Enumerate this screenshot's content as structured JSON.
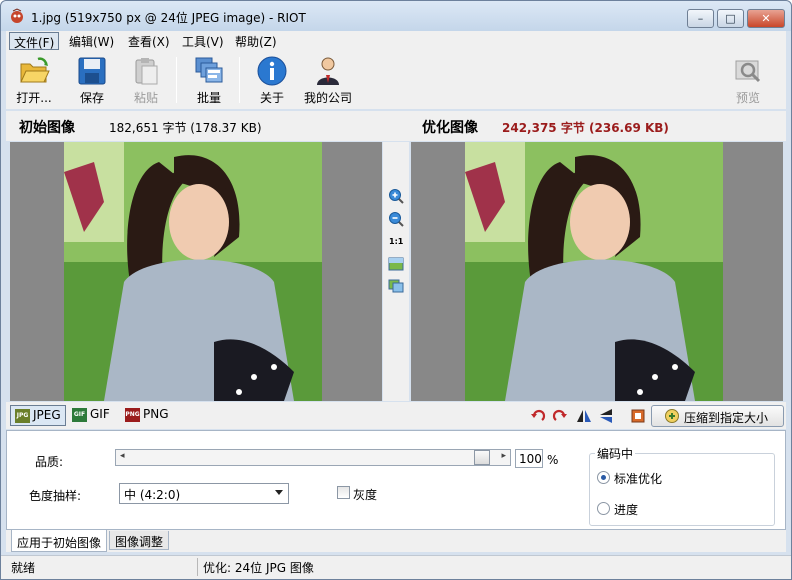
{
  "window": {
    "title": "1.jpg (519x750 px @ 24位 JPEG image) - RIOT",
    "buttons": {
      "minimize": "–",
      "maximize": "□",
      "close": "✕"
    }
  },
  "menu": [
    {
      "label": "文件(F)"
    },
    {
      "label": "编辑(W)"
    },
    {
      "label": "查看(X)"
    },
    {
      "label": "工具(V)"
    },
    {
      "label": "帮助(Z)"
    }
  ],
  "toolbar": {
    "open": "打开...",
    "save": "保存",
    "paste": "粘贴",
    "batch": "批量",
    "about": "关于",
    "company": "我的公司",
    "preview": "预览"
  },
  "original": {
    "title": "初始图像",
    "size": "182,651 字节 (178.37 KB)"
  },
  "optimized": {
    "title": "优化图像",
    "size": "242,375 字节 (236.69 KB)"
  },
  "zoom": {
    "one_to_one": "1:1"
  },
  "formats": [
    {
      "label": "JPEG",
      "icon": "jpeg-icon",
      "color": "#6b7f2a"
    },
    {
      "label": "GIF",
      "icon": "gif-icon",
      "color": "#2d7a3a"
    },
    {
      "label": "PNG",
      "icon": "png-icon",
      "color": "#9b1c1c"
    }
  ],
  "compress_button": "压缩到指定大小",
  "settings": {
    "quality_label": "品质:",
    "quality_value": "100",
    "quality_unit": "%",
    "chroma_label": "色度抽样:",
    "chroma_value": "中 (4:2:0)",
    "grayscale_label": "灰度",
    "encoding_title": "编码中",
    "encoding_options": [
      "标准优化",
      "进度"
    ]
  },
  "bottom_tabs": [
    "应用于初始图像",
    "图像调整"
  ],
  "status": {
    "left": "就绪",
    "right": "优化: 24位 JPG 图像"
  },
  "colors": {
    "accent_red": "#9b1c1c",
    "title_gradient": "#c4d6ea"
  }
}
